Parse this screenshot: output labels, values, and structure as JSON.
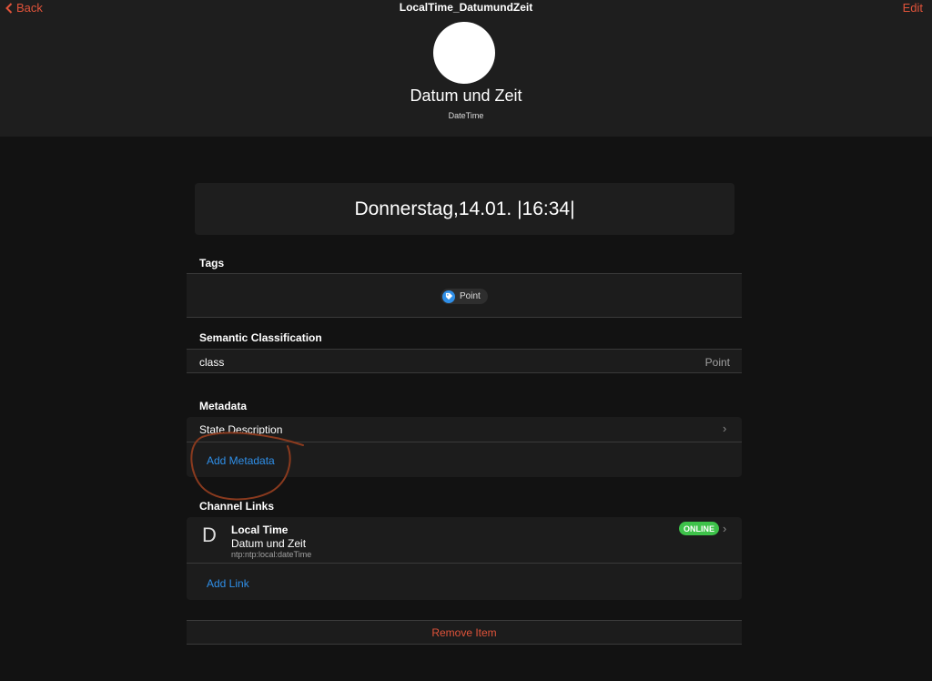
{
  "nav": {
    "back_label": "Back",
    "title": "LocalTime_DatumundZeit",
    "edit_label": "Edit"
  },
  "item": {
    "label": "Datum und Zeit",
    "type": "DateTime",
    "state": "Donnerstag,14.01. |16:34|"
  },
  "tags": {
    "title": "Tags",
    "items": [
      {
        "label": "Point",
        "icon": "tag-icon"
      }
    ]
  },
  "semantic": {
    "title": "Semantic Classification",
    "rows": [
      {
        "key": "class",
        "value": "Point"
      }
    ]
  },
  "metadata": {
    "title": "Metadata",
    "items": [
      {
        "label": "State Description"
      }
    ],
    "add_label": "Add Metadata"
  },
  "channel_links": {
    "title": "Channel Links",
    "links": [
      {
        "letter": "D",
        "channel": "Local Time",
        "label": "Datum und Zeit",
        "uid": "ntp:ntp:local:dateTime",
        "status": "ONLINE"
      }
    ],
    "add_label": "Add Link"
  },
  "remove_label": "Remove Item",
  "colors": {
    "accent": "#e0533a",
    "link_blue": "#2f8fe8",
    "online_green": "#3ec24a",
    "background": "#121212",
    "panel": "#1e1e1e"
  }
}
